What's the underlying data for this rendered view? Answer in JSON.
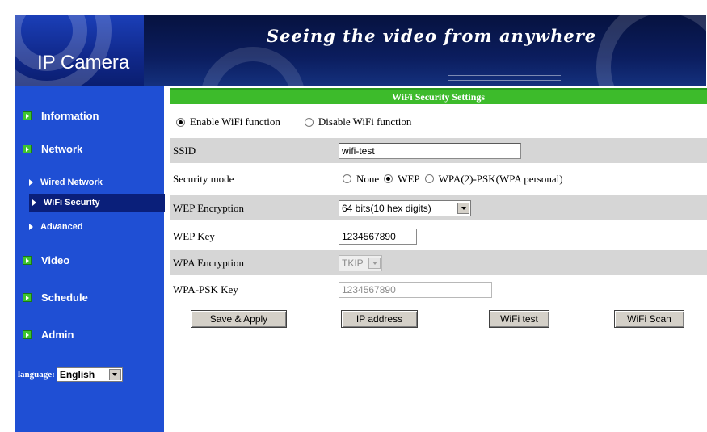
{
  "header": {
    "logo_text": "IP Camera",
    "slogan": "Seeing the video from anywhere"
  },
  "sidebar": {
    "items": [
      {
        "label": "Information"
      },
      {
        "label": "Network"
      },
      {
        "label": "Video"
      },
      {
        "label": "Schedule"
      },
      {
        "label": "Admin"
      }
    ],
    "network_sub": [
      {
        "label": "Wired Network"
      },
      {
        "label": "WiFi Security",
        "active": true
      },
      {
        "label": "Advanced"
      }
    ],
    "language": {
      "label": "language:",
      "selected": "English"
    }
  },
  "main": {
    "title": "WiFi Security Settings",
    "enable_label": "Enable WiFi function",
    "disable_label": "Disable WiFi function",
    "wifi_enabled": true,
    "ssid": {
      "label": "SSID",
      "value": "wifi-test"
    },
    "security_mode": {
      "label": "Security mode",
      "options": [
        "None",
        "WEP",
        "WPA(2)-PSK(WPA personal)"
      ],
      "selected": "WEP"
    },
    "wep_encryption": {
      "label": "WEP Encryption",
      "value": "64 bits(10 hex digits)"
    },
    "wep_key": {
      "label": "WEP Key",
      "value": "1234567890"
    },
    "wpa_encryption": {
      "label": "WPA Encryption",
      "value": "TKIP"
    },
    "wpa_psk_key": {
      "label": "WPA-PSK Key",
      "value": "1234567890"
    }
  },
  "buttons": {
    "save": "Save & Apply",
    "ip_address": "IP address",
    "wifi_test": "WiFi test",
    "wifi_scan": "WiFi Scan"
  },
  "colors": {
    "sidebar_bg": "#1f4fd4",
    "title_bar": "#3dbb2b",
    "active_sub": "#0a1f7a",
    "row_shade": "#d6d6d6"
  }
}
